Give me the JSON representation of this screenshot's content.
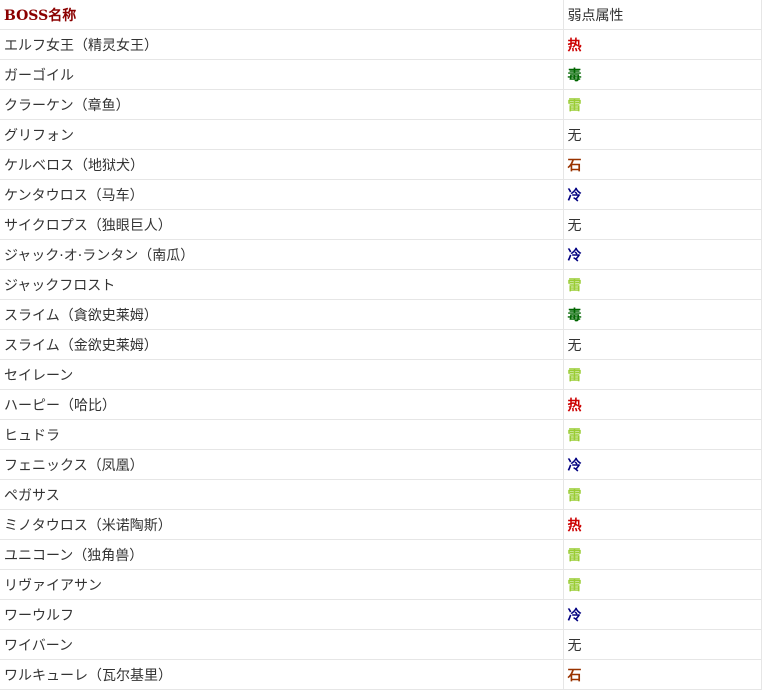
{
  "table": {
    "headers": {
      "name": "BOSS名称",
      "weakness": "弱点属性"
    },
    "rows": [
      {
        "name": "エルフ女王（精灵女王）",
        "weakness": "热",
        "color": "#cc0000"
      },
      {
        "name": "ガーゴイル",
        "weakness": "毒",
        "color": "#006600"
      },
      {
        "name": "クラーケン（章鱼）",
        "weakness": "雷",
        "color": "#99cc33"
      },
      {
        "name": "グリフォン",
        "weakness": "无",
        "color": "#333333"
      },
      {
        "name": "ケルベロス（地狱犬）",
        "weakness": "石",
        "color": "#993300"
      },
      {
        "name": "ケンタウロス（马车）",
        "weakness": "冷",
        "color": "#000080"
      },
      {
        "name": "サイクロプス（独眼巨人）",
        "weakness": "无",
        "color": "#333333"
      },
      {
        "name": "ジャック·オ·ランタン（南瓜）",
        "weakness": "冷",
        "color": "#000080"
      },
      {
        "name": "ジャックフロスト",
        "weakness": "雷",
        "color": "#99cc33"
      },
      {
        "name": "スライム（貪欲史莱姆）",
        "weakness": "毒",
        "color": "#006600"
      },
      {
        "name": "スライム（金欲史莱姆）",
        "weakness": "无",
        "color": "#333333"
      },
      {
        "name": "セイレーン",
        "weakness": "雷",
        "color": "#99cc33"
      },
      {
        "name": "ハーピー（哈比）",
        "weakness": "热",
        "color": "#cc0000"
      },
      {
        "name": "ヒュドラ",
        "weakness": "雷",
        "color": "#99cc33"
      },
      {
        "name": "フェニックス（凤凰）",
        "weakness": "冷",
        "color": "#000080"
      },
      {
        "name": "ペガサス",
        "weakness": "雷",
        "color": "#99cc33"
      },
      {
        "name": "ミノタウロス（米诺陶斯）",
        "weakness": "热",
        "color": "#cc0000"
      },
      {
        "name": "ユニコーン（独角兽）",
        "weakness": "雷",
        "color": "#99cc33"
      },
      {
        "name": "リヴァイアサン",
        "weakness": "雷",
        "color": "#99cc33"
      },
      {
        "name": "ワーウルフ",
        "weakness": "冷",
        "color": "#000080"
      },
      {
        "name": "ワイバーン",
        "weakness": "无",
        "color": "#333333"
      },
      {
        "name": "ワルキューレ（瓦尔基里）",
        "weakness": "石",
        "color": "#993300"
      }
    ]
  }
}
